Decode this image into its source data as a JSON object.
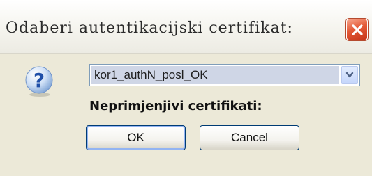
{
  "window": {
    "title": "Odaberi autentikacijski certifikat:",
    "close_icon": "close-icon"
  },
  "dialog": {
    "icon": "question-icon",
    "certificate_select": {
      "selected_value": "kor1_authN_posl_OK"
    },
    "inapplicable_label": "Neprimjenjivi certifikati:"
  },
  "buttons": {
    "ok_label": "OK",
    "cancel_label": "Cancel"
  },
  "colors": {
    "close_button": "#e45a37",
    "dialog_background": "#ece9d8",
    "select_border": "#7f9db9"
  }
}
